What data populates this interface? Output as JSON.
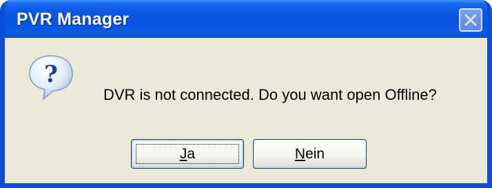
{
  "window": {
    "title": "PVR Manager",
    "close_icon": "close-icon"
  },
  "dialog": {
    "icon": "question-icon",
    "message": "DVR is not connected. Do you want open Offline?"
  },
  "buttons": {
    "yes": {
      "mnemonic": "J",
      "rest": "a",
      "label": "Ja",
      "focused": true
    },
    "no": {
      "mnemonic": "N",
      "rest": "ein",
      "label": "Nein",
      "focused": false
    }
  },
  "colors": {
    "titlebar": "#0753de",
    "dialog_background": "#ece9d8",
    "button_border": "#003c74"
  }
}
